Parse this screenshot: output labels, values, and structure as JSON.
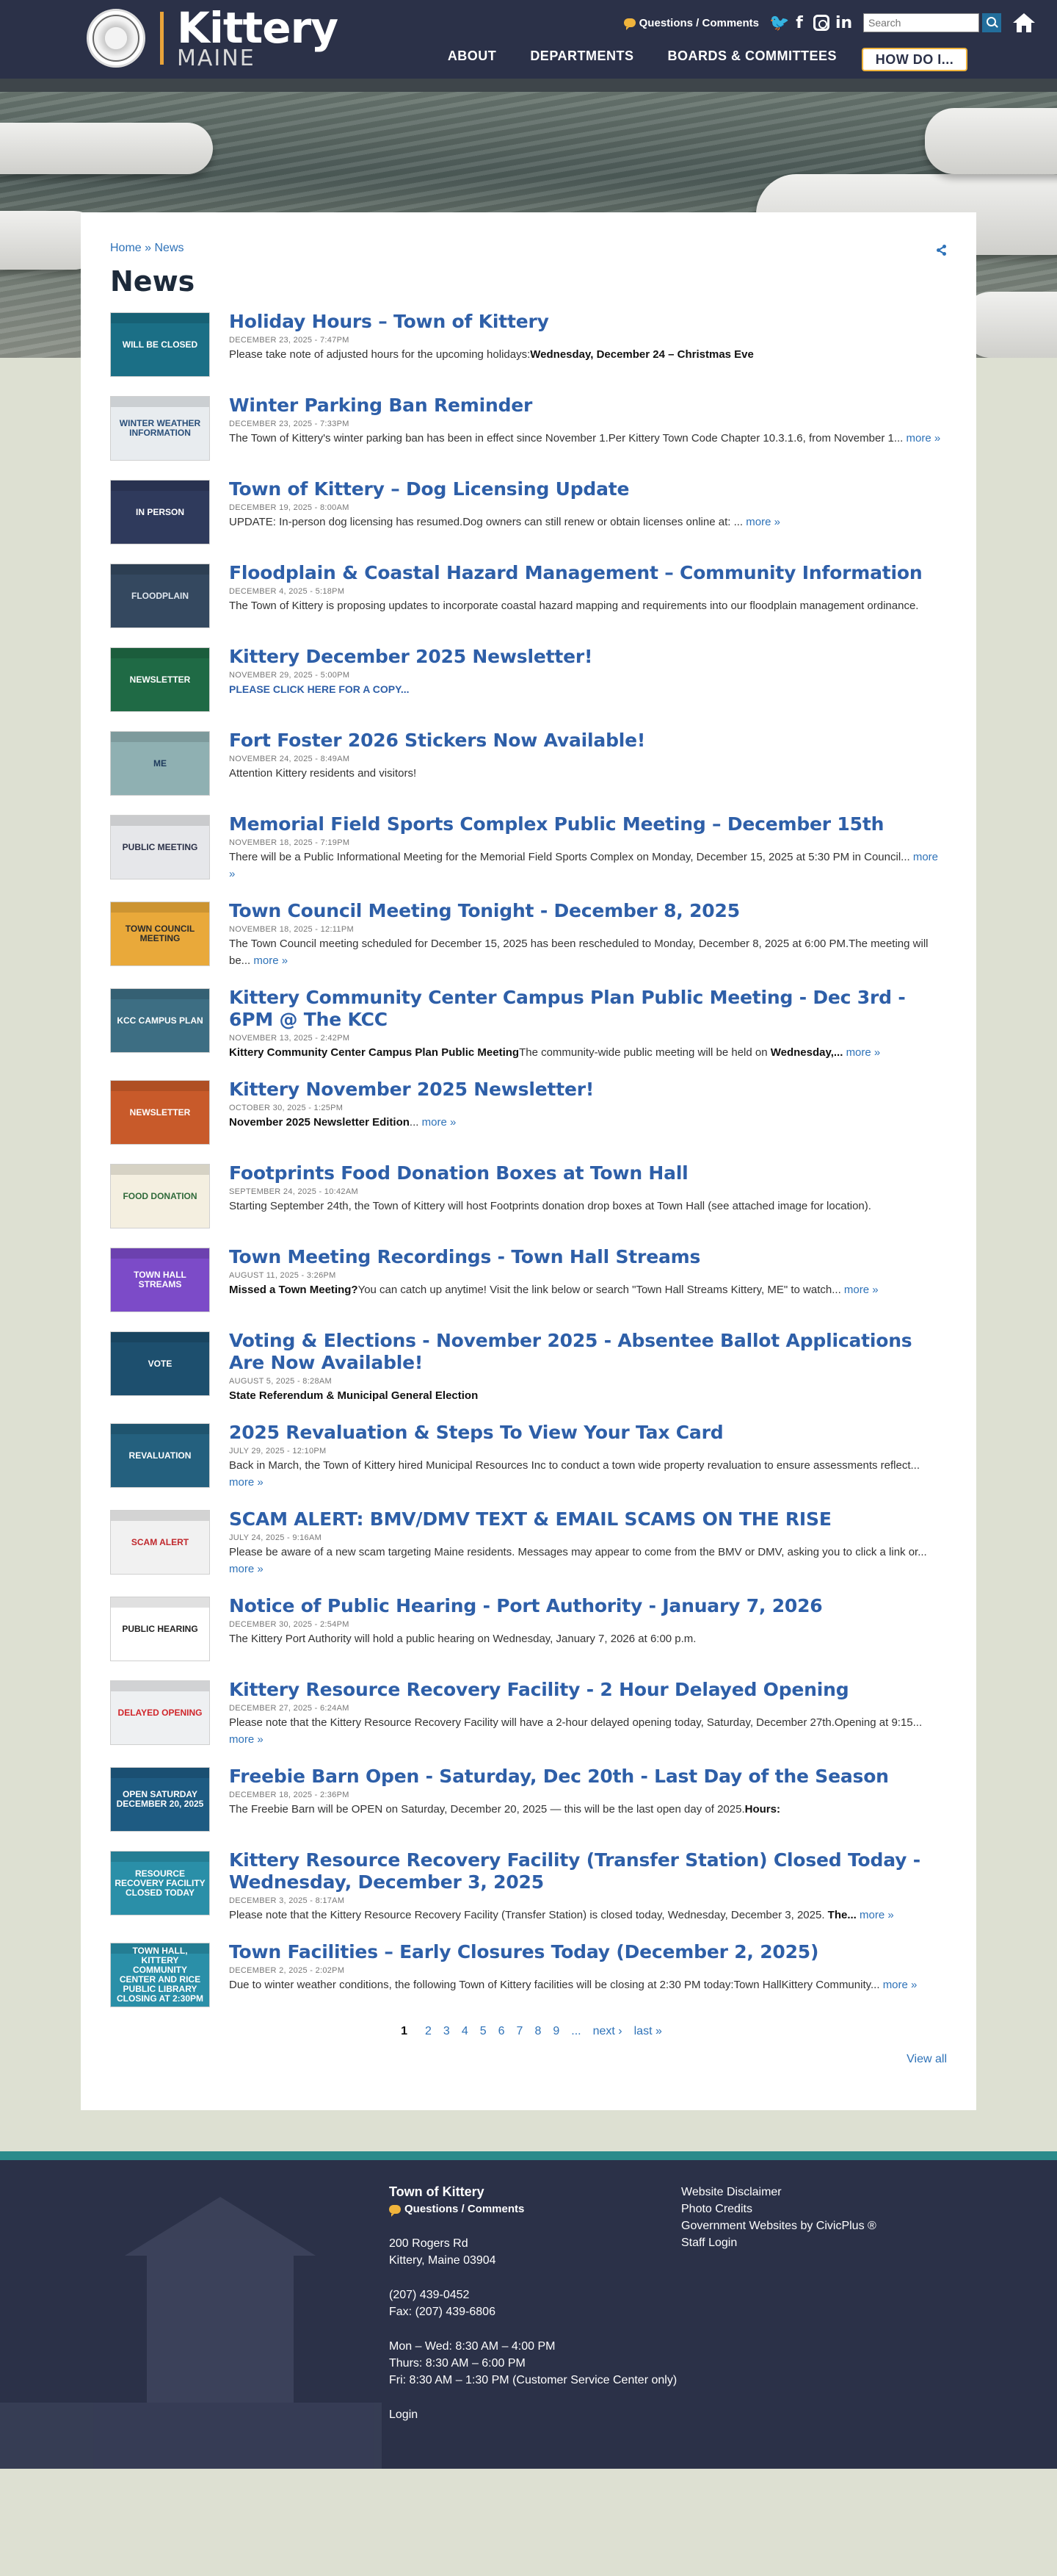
{
  "header": {
    "logo_name": "Kittery",
    "logo_state": "MAINE",
    "questions_label": "Questions / Comments",
    "search_placeholder": "Search",
    "nav": [
      "ABOUT",
      "DEPARTMENTS",
      "BOARDS & COMMITTEES"
    ],
    "how_do_i": "HOW DO I..."
  },
  "breadcrumb": {
    "home": "Home",
    "sep": "»",
    "current": "News"
  },
  "page_title": "News",
  "news": [
    {
      "title": "Holiday Hours – Town of Kittery",
      "date": "DECEMBER 23, 2025 - 7:47PM",
      "text": "Please take note of adjusted hours for the upcoming holidays:",
      "bold": "Wednesday, December 24 – Christmas Eve",
      "more": "",
      "thumb": {
        "bg": "#1b6f86",
        "fg": "#fff",
        "label": "WILL BE CLOSED"
      }
    },
    {
      "title": "Winter Parking Ban Reminder",
      "date": "DECEMBER 23, 2025 - 7:33PM",
      "text": "The Town of Kittery's winter parking ban has been in effect since November 1.Per Kittery Town Code Chapter 10.3.1.6, from November 1...",
      "bold": "",
      "more": "more »",
      "thumb": {
        "bg": "#e8ecef",
        "fg": "#2a4f7a",
        "label": "WINTER WEATHER INFORMATION"
      }
    },
    {
      "title": "Town of Kittery – Dog Licensing Update",
      "date": "DECEMBER 19, 2025 - 8:00AM",
      "text": "UPDATE: In-person dog licensing has resumed.Dog owners can still renew or obtain licenses online at: ...",
      "bold": "",
      "more": "more »",
      "thumb": {
        "bg": "#2f3a5c",
        "fg": "#fff",
        "label": "IN PERSON"
      }
    },
    {
      "title": "Floodplain & Coastal Hazard Management – Community Information",
      "date": "DECEMBER 4, 2025 - 5:18PM",
      "text": "The Town of Kittery is proposing updates to incorporate coastal hazard mapping and requirements into our floodplain management ordinance.",
      "bold": "",
      "more": "",
      "thumb": {
        "bg": "#34485f",
        "fg": "#dfe6ee",
        "label": "FLOODPLAIN"
      }
    },
    {
      "title": "Kittery December 2025 Newsletter!",
      "date": "NOVEMBER 29, 2025 - 5:00PM",
      "text": "",
      "bold": "",
      "cta": "PLEASE CLICK HERE FOR A COPY...",
      "more": "",
      "thumb": {
        "bg": "#1f6a45",
        "fg": "#fff",
        "label": "NEWSLETTER"
      }
    },
    {
      "title": "Fort Foster 2026 Stickers Now Available!",
      "date": "NOVEMBER 24, 2025 - 8:49AM",
      "text": "Attention Kittery residents and visitors!",
      "bold": "",
      "more": "",
      "thumb": {
        "bg": "#8fb0b2",
        "fg": "#1d3a5c",
        "label": "ME"
      }
    },
    {
      "title": "Memorial Field Sports Complex Public Meeting – December 15th",
      "date": "NOVEMBER 18, 2025 - 7:19PM",
      "text": "There will be a Public Informational Meeting for the Memorial Field Sports Complex on Monday, December 15, 2025 at 5:30 PM in Council...",
      "bold": "",
      "more": "more »",
      "thumb": {
        "bg": "#e6e7ea",
        "fg": "#2b3148",
        "label": "PUBLIC MEETING"
      }
    },
    {
      "title": "Town Council Meeting Tonight - December 8, 2025",
      "date": "NOVEMBER 18, 2025 - 12:11PM",
      "text": "The Town Council meeting scheduled for December 15, 2025 has been rescheduled to Monday, December 8, 2025 at 6:00 PM.The meeting will be...",
      "bold": "",
      "more": "more »",
      "thumb": {
        "bg": "#e9a93a",
        "fg": "#2b2b2b",
        "label": "TOWN COUNCIL MEETING"
      }
    },
    {
      "title": "Kittery Community Center Campus Plan Public Meeting - Dec 3rd - 6PM @ The KCC",
      "date": "NOVEMBER 13, 2025 - 2:42PM",
      "text": "",
      "bold": "Kittery Community Center Campus Plan Public Meeting",
      "text2": "The community-wide public meeting will be held on ",
      "bold2": "Wednesday,...",
      "more": "more »",
      "thumb": {
        "bg": "#3d6e83",
        "fg": "#fff",
        "label": "KCC CAMPUS PLAN"
      }
    },
    {
      "title": "Kittery November 2025 Newsletter!",
      "date": "OCTOBER 30, 2025 - 1:25PM",
      "text": "",
      "bold": "November 2025 Newsletter Edition",
      "tail": "...",
      "more": "more »",
      "thumb": {
        "bg": "#c85a2a",
        "fg": "#fff",
        "label": "NEWSLETTER"
      }
    },
    {
      "title": "Footprints Food Donation Boxes at Town Hall",
      "date": "SEPTEMBER 24, 2025 - 10:42AM",
      "text": "Starting September 24th, the Town of Kittery will host Footprints donation drop boxes at Town Hall (see attached image for location).",
      "bold": "",
      "more": "",
      "thumb": {
        "bg": "#f4efe0",
        "fg": "#2f6a3a",
        "label": "FOOD DONATION"
      }
    },
    {
      "title": "Town Meeting Recordings - Town Hall Streams",
      "date": "AUGUST 11, 2025 - 3:26PM",
      "text": "",
      "bold": "Missed a Town Meeting?",
      "text2": "You can catch up anytime! Visit the link below or search \"Town Hall Streams Kittery, ME\" to watch...",
      "more": "more »",
      "thumb": {
        "bg": "#7c4bc8",
        "fg": "#fff",
        "label": "TOWN HALL STREAMS"
      }
    },
    {
      "title": "Voting & Elections - November 2025 - Absentee Ballot Applications Are Now Available!",
      "date": "AUGUST 5, 2025 - 8:28AM",
      "text": "",
      "bold": "State Referendum & Municipal General Election",
      "more": "",
      "thumb": {
        "bg": "#1d4f6e",
        "fg": "#fff",
        "label": "VOTE"
      }
    },
    {
      "title": "2025 Revaluation & Steps To View Your Tax Card",
      "date": "JULY 29, 2025 - 12:10PM",
      "text": "Back in March, the Town of Kittery hired Municipal Resources Inc to conduct a town wide property revaluation to ensure assessments reflect...",
      "bold": "",
      "more": "more »",
      "thumb": {
        "bg": "#24607e",
        "fg": "#fff",
        "label": "REVALUATION"
      }
    },
    {
      "title": "SCAM ALERT: BMV/DMV TEXT & EMAIL SCAMS ON THE RISE",
      "date": "JULY 24, 2025 - 9:16AM",
      "text": "Please be aware of a new scam targeting Maine residents. Messages may appear to come from the BMV or DMV, asking you to click a link or...",
      "bold": "",
      "more": "more »",
      "thumb": {
        "bg": "#f1f1f1",
        "fg": "#c0282d",
        "label": "SCAM ALERT"
      }
    },
    {
      "title": "Notice of Public Hearing - Port Authority - January 7, 2026",
      "date": "DECEMBER 30, 2025 - 2:54PM",
      "text": "The Kittery Port Authority will hold a public hearing on Wednesday, January 7, 2026 at 6:00 p.m.",
      "bold": "",
      "more": "",
      "thumb": {
        "bg": "#ffffff",
        "fg": "#222",
        "label": "PUBLIC HEARING"
      }
    },
    {
      "title": "Kittery Resource Recovery Facility - 2 Hour Delayed Opening",
      "date": "DECEMBER 27, 2025 - 6:24AM",
      "text": "Please note that the Kittery Resource Recovery Facility will have a 2-hour delayed opening today, Saturday, December 27th.Opening at 9:15...",
      "bold": "",
      "more": "more »",
      "thumb": {
        "bg": "#eef0f2",
        "fg": "#d0262b",
        "label": "DELAYED OPENING"
      }
    },
    {
      "title": "Freebie Barn Open - Saturday, Dec 20th - Last Day of the Season",
      "date": "DECEMBER 18, 2025 - 2:36PM",
      "text": "The Freebie Barn will be OPEN on Saturday, December 20, 2025 — this will be the last open day of 2025.",
      "bold": "Hours:",
      "more": "",
      "thumb": {
        "bg": "#1e5b82",
        "fg": "#fff",
        "label": "OPEN SATURDAY DECEMBER 20, 2025"
      }
    },
    {
      "title": "Kittery Resource Recovery Facility (Transfer Station) Closed Today - Wednesday, December 3, 2025",
      "date": "DECEMBER 3, 2025 - 8:17AM",
      "text": "Please note that the Kittery Resource Recovery Facility (Transfer Station) is closed today, Wednesday, December 3, 2025.",
      "bold": " The...",
      "more": "more »",
      "thumb": {
        "bg": "#2a8fa8",
        "fg": "#fff",
        "label": "RESOURCE RECOVERY FACILITY CLOSED TODAY"
      }
    },
    {
      "title": "Town Facilities – Early Closures Today (December 2, 2025)",
      "date": "DECEMBER 2, 2025 - 2:02PM",
      "text": "Due to winter weather conditions, the following Town of Kittery facilities will be closing at 2:30 PM today:Town HallKittery Community...",
      "bold": "",
      "more": "more »",
      "thumb": {
        "bg": "#2a8fa8",
        "fg": "#fff",
        "label": "TOWN HALL, KITTERY COMMUNITY CENTER AND RICE PUBLIC LIBRARY CLOSING AT 2:30PM"
      }
    }
  ],
  "pager": {
    "pages": [
      "1",
      "2",
      "3",
      "4",
      "5",
      "6",
      "7",
      "8",
      "9"
    ],
    "ellipsis": "...",
    "next": "next ›",
    "last": "last »",
    "current": "1"
  },
  "view_all": "View all",
  "footer": {
    "org": "Town of Kittery",
    "questions_label": "Questions / Comments",
    "address1": "200 Rogers Rd",
    "address2": "Kittery, Maine 03904",
    "phone": "(207) 439-0452",
    "fax": "Fax: (207) 439-6806",
    "hours1": "Mon – Wed: 8:30 AM – 4:00 PM",
    "hours2": "Thurs: 8:30 AM – 6:00 PM",
    "hours3": "Fri: 8:30 AM – 1:30 PM (Customer Service Center only)",
    "login": "Login",
    "links": [
      "Website Disclaimer",
      "Photo Credits",
      "Government Websites by CivicPlus ®",
      "Staff Login"
    ]
  }
}
